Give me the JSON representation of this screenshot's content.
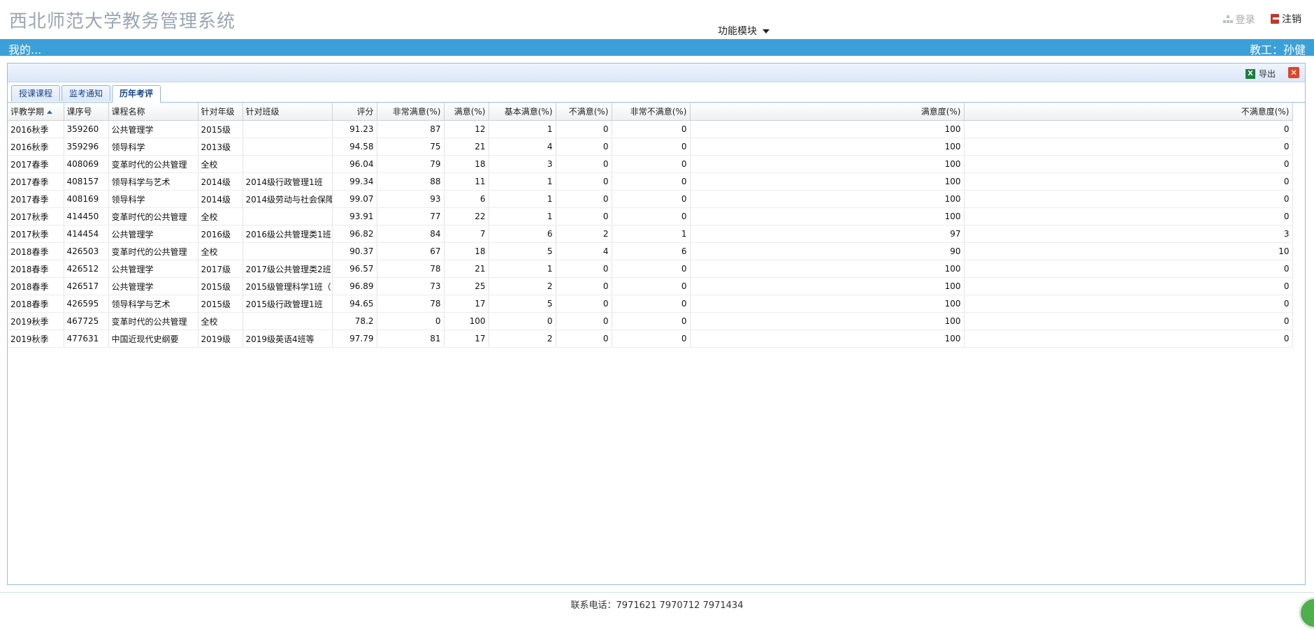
{
  "header": {
    "title": "西北师范大学教务管理系统",
    "module_menu_label": "功能模块",
    "login_label": "登录",
    "logout_label": "注销"
  },
  "nav": {
    "left_label": "我的...",
    "right_label": "教工：孙健"
  },
  "toolbar": {
    "export_label": "导出"
  },
  "tabs": [
    {
      "label": "授课课程",
      "active": false
    },
    {
      "label": "监考通知",
      "active": false
    },
    {
      "label": "历年考评",
      "active": true
    }
  ],
  "table": {
    "columns": [
      "评教学期",
      "课序号",
      "课程名称",
      "针对年级",
      "针对班级",
      "评分",
      "非常满意(%)",
      "满意(%)",
      "基本满意(%)",
      "不满意(%)",
      "非常不满意(%)",
      "满意度(%)",
      "不满意度(%)"
    ],
    "sort_column": "评教学期",
    "sort_direction": "asc",
    "rows": [
      [
        "2016秋季",
        "359260",
        "公共管理学",
        "2015级",
        "",
        "91.23",
        "87",
        "12",
        "1",
        "0",
        "0",
        "100",
        "0"
      ],
      [
        "2016秋季",
        "359296",
        "领导科学",
        "2013级",
        "",
        "94.58",
        "75",
        "21",
        "4",
        "0",
        "0",
        "100",
        "0"
      ],
      [
        "2017春季",
        "408069",
        "变革时代的公共管理",
        "全校",
        "",
        "96.04",
        "79",
        "18",
        "3",
        "0",
        "0",
        "100",
        "0"
      ],
      [
        "2017春季",
        "408157",
        "领导科学与艺术",
        "2014级",
        "2014级行政管理1班",
        "99.34",
        "88",
        "11",
        "1",
        "0",
        "0",
        "100",
        "0"
      ],
      [
        "2017春季",
        "408169",
        "领导科学",
        "2014级",
        "2014级劳动与社会保障",
        "99.07",
        "93",
        "6",
        "1",
        "0",
        "0",
        "100",
        "0"
      ],
      [
        "2017秋季",
        "414450",
        "变革时代的公共管理",
        "全校",
        "",
        "93.91",
        "77",
        "22",
        "1",
        "0",
        "0",
        "100",
        "0"
      ],
      [
        "2017秋季",
        "414454",
        "公共管理学",
        "2016级",
        "2016级公共管理类1班",
        "96.82",
        "84",
        "7",
        "6",
        "2",
        "1",
        "97",
        "3"
      ],
      [
        "2018春季",
        "426503",
        "变革时代的公共管理",
        "全校",
        "",
        "90.37",
        "67",
        "18",
        "5",
        "4",
        "6",
        "90",
        "10"
      ],
      [
        "2018春季",
        "426512",
        "公共管理学",
        "2017级",
        "2017级公共管理类2班",
        "96.57",
        "78",
        "21",
        "1",
        "0",
        "0",
        "100",
        "0"
      ],
      [
        "2018春季",
        "426517",
        "公共管理学",
        "2015级",
        "2015级管理科学1班（",
        "96.89",
        "73",
        "25",
        "2",
        "0",
        "0",
        "100",
        "0"
      ],
      [
        "2018春季",
        "426595",
        "领导科学与艺术",
        "2015级",
        "2015级行政管理1班",
        "94.65",
        "78",
        "17",
        "5",
        "0",
        "0",
        "100",
        "0"
      ],
      [
        "2019秋季",
        "467725",
        "变革时代的公共管理",
        "全校",
        "",
        "78.2",
        "0",
        "100",
        "0",
        "0",
        "0",
        "100",
        "0"
      ],
      [
        "2019秋季",
        "477631",
        "中国近现代史纲要",
        "2019级",
        "2019级英语4班等",
        "97.79",
        "81",
        "17",
        "2",
        "0",
        "0",
        "100",
        "0"
      ]
    ]
  },
  "footer": {
    "contact": "联系电话：7971621 7970712 7971434"
  },
  "colors": {
    "nav_bar": "#3ca0d8",
    "title": "#9aa6b4",
    "panel_border": "#99bbe8",
    "tab_text": "#15428b"
  }
}
